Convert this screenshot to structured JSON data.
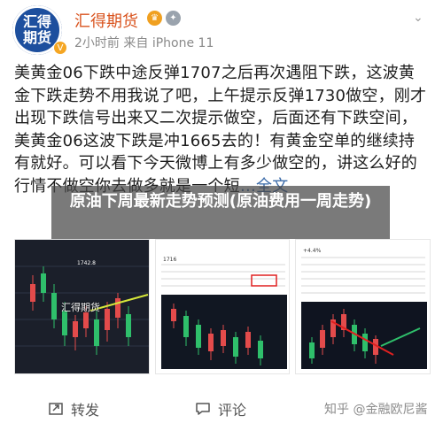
{
  "header": {
    "avatar_text_line1": "汇得",
    "avatar_text_line2": "期货",
    "username": "汇得期货",
    "time": "2小时前",
    "source": "来自 iPhone 11",
    "menu_glyph": "⌄",
    "vip_glyph": "V"
  },
  "post": {
    "text": "美黄金06下跌中途反弹1707之后再次遇阻下跌，这波黄金下跌走势不用我说了吧，上午提示反弹1730做空，刚才出现下跌信号出来又二次提示做空，后面还有下跌空间，美黄金06这波下跌是冲1665去的！有黄金空单的继续持有就好。可以看下今天微博上有多少做空的，讲这么好的行情不做空你去做多就是一个短",
    "more_label": "…全文"
  },
  "overlay": {
    "title": "原油下周最新走势预测(原油费用一周走势)"
  },
  "gallery": {
    "watermark": "汇得期货",
    "images": [
      {
        "name": "chart-image-1",
        "label": "1742.8"
      },
      {
        "name": "chart-image-2",
        "label": "1716"
      },
      {
        "name": "chart-image-3",
        "label": "+4.4%"
      }
    ]
  },
  "actions": {
    "repost_label": "转发",
    "comment_label": "评论"
  },
  "footer": {
    "watermark": "知乎 @金融欧尼酱"
  },
  "colors": {
    "username": "#d9531e",
    "link": "#3a6aa8",
    "avatar_bg": "#1d4f9e"
  }
}
